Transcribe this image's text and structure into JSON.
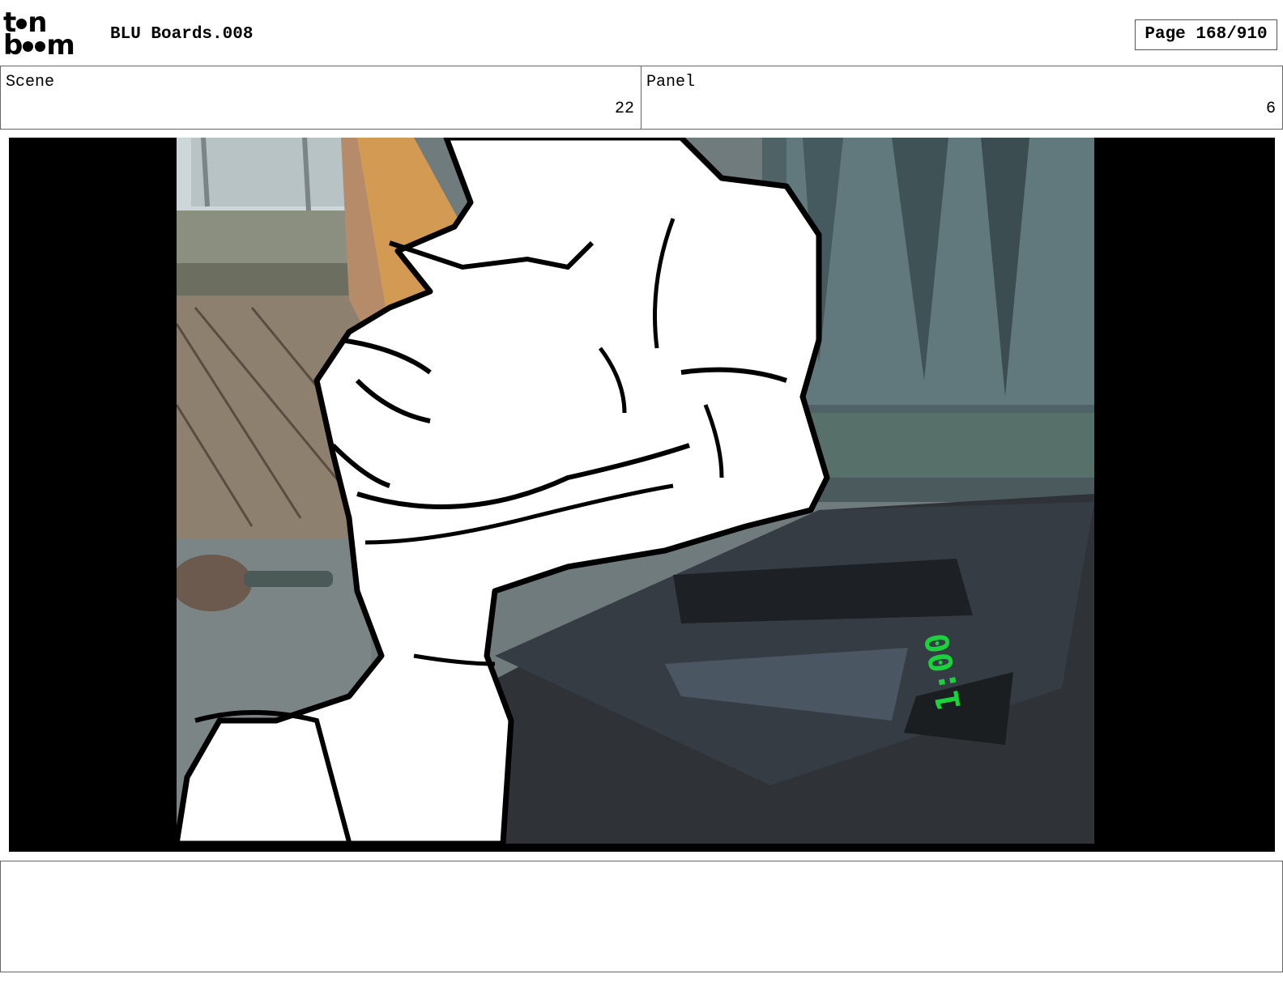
{
  "header": {
    "logo_text_top": "toon",
    "logo_text_bottom": "boom",
    "title": "BLU Boards.008",
    "page_label": "Page 168/910"
  },
  "info": {
    "scene_label": "Scene",
    "scene_value": "22",
    "panel_label": "Panel",
    "panel_value": "6"
  },
  "frame": {
    "clock_display": "1:00",
    "clock_color": "#19d23c"
  },
  "notes": {
    "text": ""
  }
}
